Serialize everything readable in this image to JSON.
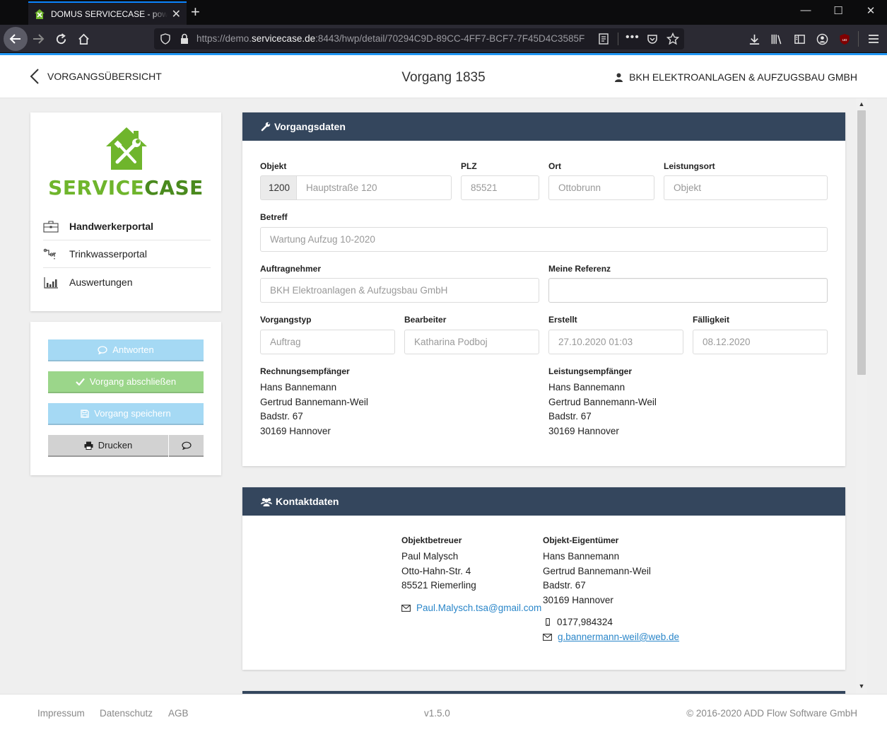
{
  "browser": {
    "tab_title": "DOMUS SERVICECASE - powered by ADD Flow Software",
    "url_prefix": "https://demo.",
    "url_domain": "servicecase.de",
    "url_rest": ":8443/hwp/detail/70294C9D-89CC-4FF7-BCF7-7F45D4C3585F",
    "new_tab": "+",
    "min": "—",
    "max": "☐",
    "close": "✕"
  },
  "header": {
    "back_label": "VORGANGSÜBERSICHT",
    "title": "Vorgang 1835",
    "company": "BKH ELEKTROANLAGEN & AUFZUGSBAU GMBH"
  },
  "logo": {
    "part1": "SERVICE",
    "part2": "CASE",
    "color1": "#6fb52c",
    "color2": "#4a8a1e"
  },
  "nav": [
    {
      "label": "Handwerkerportal",
      "icon": "briefcase-icon",
      "active": true
    },
    {
      "label": "Trinkwasserportal",
      "icon": "water-pipe-icon",
      "active": false
    },
    {
      "label": "Auswertungen",
      "icon": "bar-chart-icon",
      "active": false
    }
  ],
  "actions": {
    "answer": "Antworten",
    "close": "Vorgang abschließen",
    "save": "Vorgang speichern",
    "print": "Drucken"
  },
  "vorgangsdaten": {
    "heading": "Vorgangsdaten",
    "objekt_label": "Objekt",
    "objekt_nr": "1200",
    "objekt_street": "Hauptstraße 120",
    "plz_label": "PLZ",
    "plz": "85521",
    "ort_label": "Ort",
    "ort": "Ottobrunn",
    "leistungsort_label": "Leistungsort",
    "leistungsort": "Objekt",
    "betreff_label": "Betreff",
    "betreff": "Wartung Aufzug 10-2020",
    "auftragnehmer_label": "Auftragnehmer",
    "auftragnehmer": "BKH Elektroanlagen & Aufzugsbau GmbH",
    "referenz_label": "Meine Referenz",
    "referenz": "",
    "vorgangstyp_label": "Vorgangstyp",
    "vorgangstyp": "Auftrag",
    "bearbeiter_label": "Bearbeiter",
    "bearbeiter": "Katharina Podboj",
    "erstellt_label": "Erstellt",
    "erstellt": "27.10.2020 01:03",
    "faelligkeit_label": "Fälligkeit",
    "faelligkeit": "08.12.2020",
    "rechnung_label": "Rechnungsempfänger",
    "rechnung": [
      "Hans Bannemann",
      "Gertrud Bannemann-Weil",
      "Badstr. 67",
      "30169 Hannover"
    ],
    "leistung_label": "Leistungsempfänger",
    "leistung": [
      "Hans Bannemann",
      "Gertrud Bannemann-Weil",
      "Badstr. 67",
      "30169 Hannover"
    ]
  },
  "kontakt": {
    "heading": "Kontaktdaten",
    "betreuer_label": "Objektbetreuer",
    "betreuer": [
      "Paul Malysch",
      "Otto-Hahn-Str. 4",
      "85521 Riemerling"
    ],
    "betreuer_email": "Paul.Malysch.tsa@gmail.com",
    "eigentuemer_label": "Objekt-Eigentümer",
    "eigentuemer": [
      "Hans Bannemann",
      "Gertrud Bannemann-Weil",
      "Badstr. 67",
      "30169 Hannover"
    ],
    "eigentuemer_phone": "0177,984324",
    "eigentuemer_email": "g.bannermann-weil@web.de"
  },
  "footer": {
    "impressum": "Impressum",
    "datenschutz": "Datenschutz",
    "agb": "AGB",
    "version": "v1.5.0",
    "copyright": "© 2016-2020 ADD Flow Software GmbH"
  },
  "colors": {
    "panel_header": "#34465d",
    "btn_info": "#a5d9f4",
    "btn_success": "#9bd68a",
    "link": "#2a86c9"
  }
}
